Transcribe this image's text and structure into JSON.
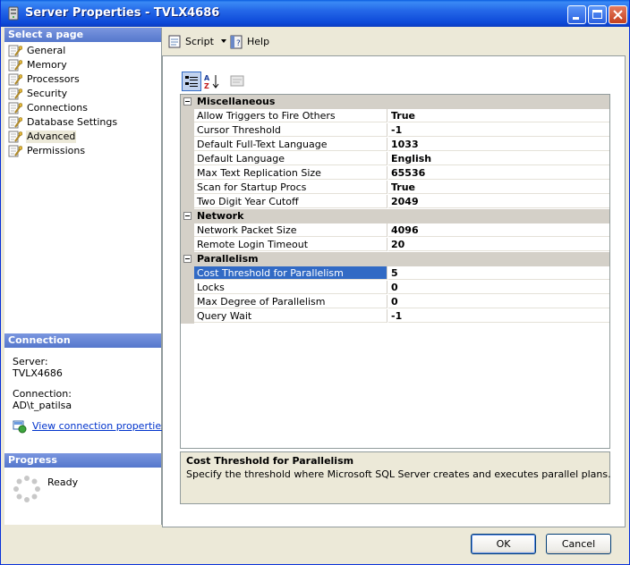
{
  "window": {
    "title": "Server Properties - TVLX4686",
    "colors": {
      "titlebar": "#0a5de0",
      "selection": "#316ac5",
      "link": "#0033cc"
    }
  },
  "left": {
    "select_page_header": "Select a page",
    "pages": [
      {
        "label": "General",
        "icon": "wrench-page-icon"
      },
      {
        "label": "Memory",
        "icon": "wrench-page-icon"
      },
      {
        "label": "Processors",
        "icon": "wrench-page-icon"
      },
      {
        "label": "Security",
        "icon": "wrench-page-icon"
      },
      {
        "label": "Connections",
        "icon": "wrench-page-icon"
      },
      {
        "label": "Database Settings",
        "icon": "wrench-page-icon"
      },
      {
        "label": "Advanced",
        "icon": "wrench-page-icon",
        "selected": true
      },
      {
        "label": "Permissions",
        "icon": "wrench-page-icon"
      }
    ],
    "connection_header": "Connection",
    "server_label": "Server:",
    "server_value": "TVLX4686",
    "connection_label": "Connection:",
    "connection_value": "AD\\t_patilsa",
    "view_link": "View connection properties",
    "progress_header": "Progress",
    "progress_status": "Ready"
  },
  "toolbar": {
    "script_label": "Script",
    "help_label": "Help"
  },
  "grid": {
    "categories": [
      {
        "title": "Miscellaneous",
        "props": [
          {
            "name": "Allow Triggers to Fire Others",
            "value": "True"
          },
          {
            "name": "Cursor Threshold",
            "value": "-1"
          },
          {
            "name": "Default Full-Text Language",
            "value": "1033"
          },
          {
            "name": "Default Language",
            "value": "English"
          },
          {
            "name": "Max Text Replication Size",
            "value": "65536"
          },
          {
            "name": "Scan for Startup Procs",
            "value": "True"
          },
          {
            "name": "Two Digit Year Cutoff",
            "value": "2049"
          }
        ]
      },
      {
        "title": "Network",
        "props": [
          {
            "name": "Network Packet Size",
            "value": "4096"
          },
          {
            "name": "Remote Login Timeout",
            "value": "20"
          }
        ]
      },
      {
        "title": "Parallelism",
        "props": [
          {
            "name": "Cost Threshold for Parallelism",
            "value": "5",
            "selected": true
          },
          {
            "name": "Locks",
            "value": "0"
          },
          {
            "name": "Max Degree of Parallelism",
            "value": "0"
          },
          {
            "name": "Query Wait",
            "value": "-1"
          }
        ]
      }
    ]
  },
  "description": {
    "title": "Cost Threshold for Parallelism",
    "text": "Specify the threshold where Microsoft SQL Server creates and executes parallel plans."
  },
  "buttons": {
    "ok": "OK",
    "cancel": "Cancel"
  }
}
